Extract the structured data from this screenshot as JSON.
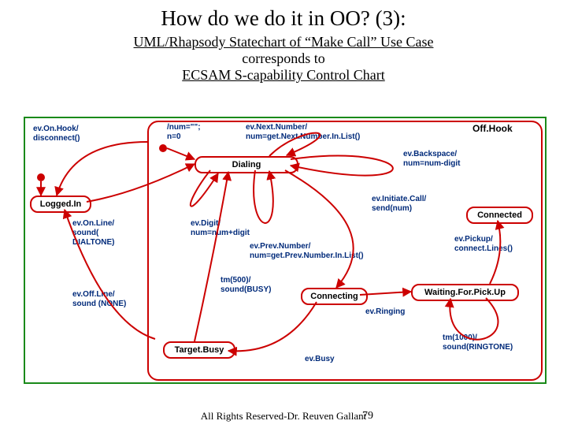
{
  "title": "How do we do it in OO? (3):",
  "subtitle": "UML/Rhapsody Statechart of “Make Call” Use Case",
  "subtitle2": "corresponds to",
  "subtitle3": "ECSAM S-capability Control Chart",
  "footer": "All Rights Reserved-Dr. Reuven Gallant",
  "pagenum": "79",
  "states": {
    "offhook": "Off.Hook",
    "loggedin": "Logged.In",
    "dialing": "Dialing",
    "connected": "Connected",
    "connecting": "Connecting",
    "waiting": "Waiting.For.Pick.Up",
    "targetbusy": "Target.Busy"
  },
  "transitions": {
    "onhook": "ev.On.Hook/\ndisconnect()",
    "init": "/num=\"\";\nn=0",
    "nextnum": "ev.Next.Number/\nnum=get.Next.Number.In.List()",
    "backspace": "ev.Backspace/\nnum=num-digit",
    "online": "ev.On.Line/\nsound(\nDIALTONE)",
    "digit": "ev.Digit/\nnum=num+digit",
    "prevnum": "ev.Prev.Number/\nnum=get.Prev.Number.In.List()",
    "initiate": "ev.Initiate.Call/\nsend(num)",
    "offline": "ev.Off.Line/\nsound (NONE)",
    "tm500": "tm(500)/\nsound(BUSY)",
    "ringing": "ev.Ringing",
    "busy": "ev.Busy",
    "pickup": "ev.Pickup/\nconnect.Lines()",
    "tm1000": "tm(1000)/\nsound(RINGTONE)"
  }
}
